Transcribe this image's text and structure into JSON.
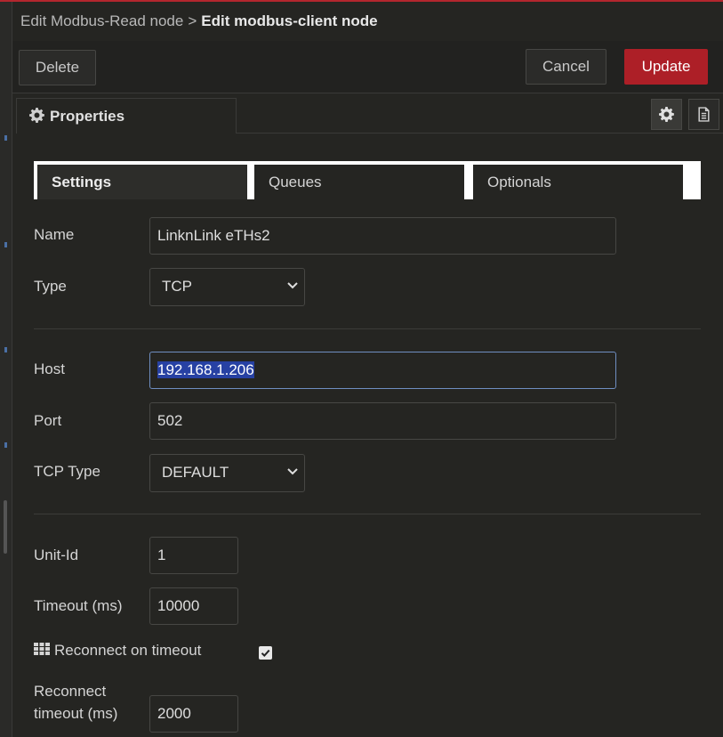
{
  "header": {
    "parent": "Edit Modbus-Read node",
    "separator": ">",
    "current": "Edit modbus-client node"
  },
  "toolbar": {
    "delete_label": "Delete",
    "cancel_label": "Cancel",
    "update_label": "Update"
  },
  "tabs": {
    "properties_label": "Properties",
    "properties_icon": "gear-icon",
    "description_icon": "document-icon"
  },
  "subtabs": [
    {
      "label": "Settings",
      "active": true
    },
    {
      "label": "Queues",
      "active": false
    },
    {
      "label": "Optionals",
      "active": false
    }
  ],
  "form": {
    "name": {
      "label": "Name",
      "value": "LinknLink eTHs2"
    },
    "type": {
      "label": "Type",
      "value": "TCP"
    },
    "host": {
      "label": "Host",
      "value": "192.168.1.206"
    },
    "port": {
      "label": "Port",
      "value": "502"
    },
    "tcp_type": {
      "label": "TCP Type",
      "value": "DEFAULT"
    },
    "unit_id": {
      "label": "Unit-Id",
      "value": "1"
    },
    "timeout": {
      "label": "Timeout (ms)",
      "value": "10000"
    },
    "reconnect_on_timeout": {
      "label": "Reconnect on timeout",
      "checked": true,
      "icon": "grid-icon"
    },
    "reconnect_timeout": {
      "label_line1": "Reconnect",
      "label_line2": "timeout (ms)",
      "value": "2000"
    }
  },
  "colors": {
    "accent": "#ad1f27",
    "background": "#1f1f1d",
    "focus_border": "#6f8ec1",
    "selection": "#2741a3"
  }
}
